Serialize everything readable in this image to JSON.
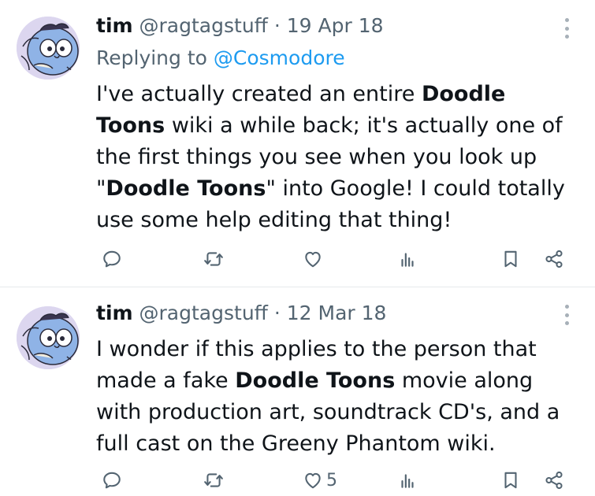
{
  "tweets": [
    {
      "name": "tim",
      "handle": "@ragtagstuff",
      "separator": "·",
      "date": "19 Apr 18",
      "replying_prefix": "Replying to",
      "replying_to": "@Cosmodore",
      "body": {
        "p1": "I've actually created an entire ",
        "b1": "Doodle Toons",
        "p2": " wiki a while back; it's actually one of the first things you see when you look up \"",
        "b2": "Doodle Toons",
        "p3": "\" into Google! I could totally use some help editing that thing!"
      },
      "actions": {
        "reply_icon": "reply-icon",
        "retweet_icon": "retweet-icon",
        "like_icon": "like-icon",
        "like_count": "",
        "views_icon": "views-icon",
        "bookmark_icon": "bookmark-icon",
        "share_icon": "share-icon"
      }
    },
    {
      "name": "tim",
      "handle": "@ragtagstuff",
      "separator": "·",
      "date": "12 Mar 18",
      "body": {
        "p1": "I wonder if this applies to the person that made a fake ",
        "b1": "Doodle Toons",
        "p2": " movie along with production art, soundtrack CD's, and a full cast on the Greeny Phantom wiki."
      },
      "actions": {
        "reply_icon": "reply-icon",
        "retweet_icon": "retweet-icon",
        "like_icon": "like-icon",
        "like_count": "5",
        "views_icon": "views-icon",
        "bookmark_icon": "bookmark-icon",
        "share_icon": "share-icon"
      }
    }
  ],
  "colors": {
    "text": "#0f1419",
    "secondary": "#536471",
    "link": "#1d9bf0",
    "divider": "#e6e9ec",
    "avatar_bg": "#dcd6ef"
  }
}
